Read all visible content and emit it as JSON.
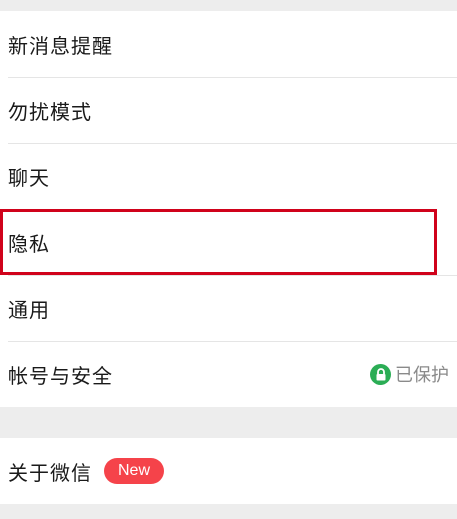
{
  "settings": {
    "group1": [
      {
        "label": "新消息提醒"
      },
      {
        "label": "勿扰模式"
      },
      {
        "label": "聊天"
      },
      {
        "label": "隐私"
      },
      {
        "label": "通用"
      },
      {
        "label": "帐号与安全",
        "status": "已保护",
        "status_icon": "lock-icon"
      }
    ],
    "group2": [
      {
        "label": "关于微信",
        "badge": "New"
      }
    ]
  },
  "colors": {
    "background": "#ededed",
    "highlight_border": "#d0021b",
    "lock_green": "#2bad55",
    "badge_red": "#f5434a"
  }
}
